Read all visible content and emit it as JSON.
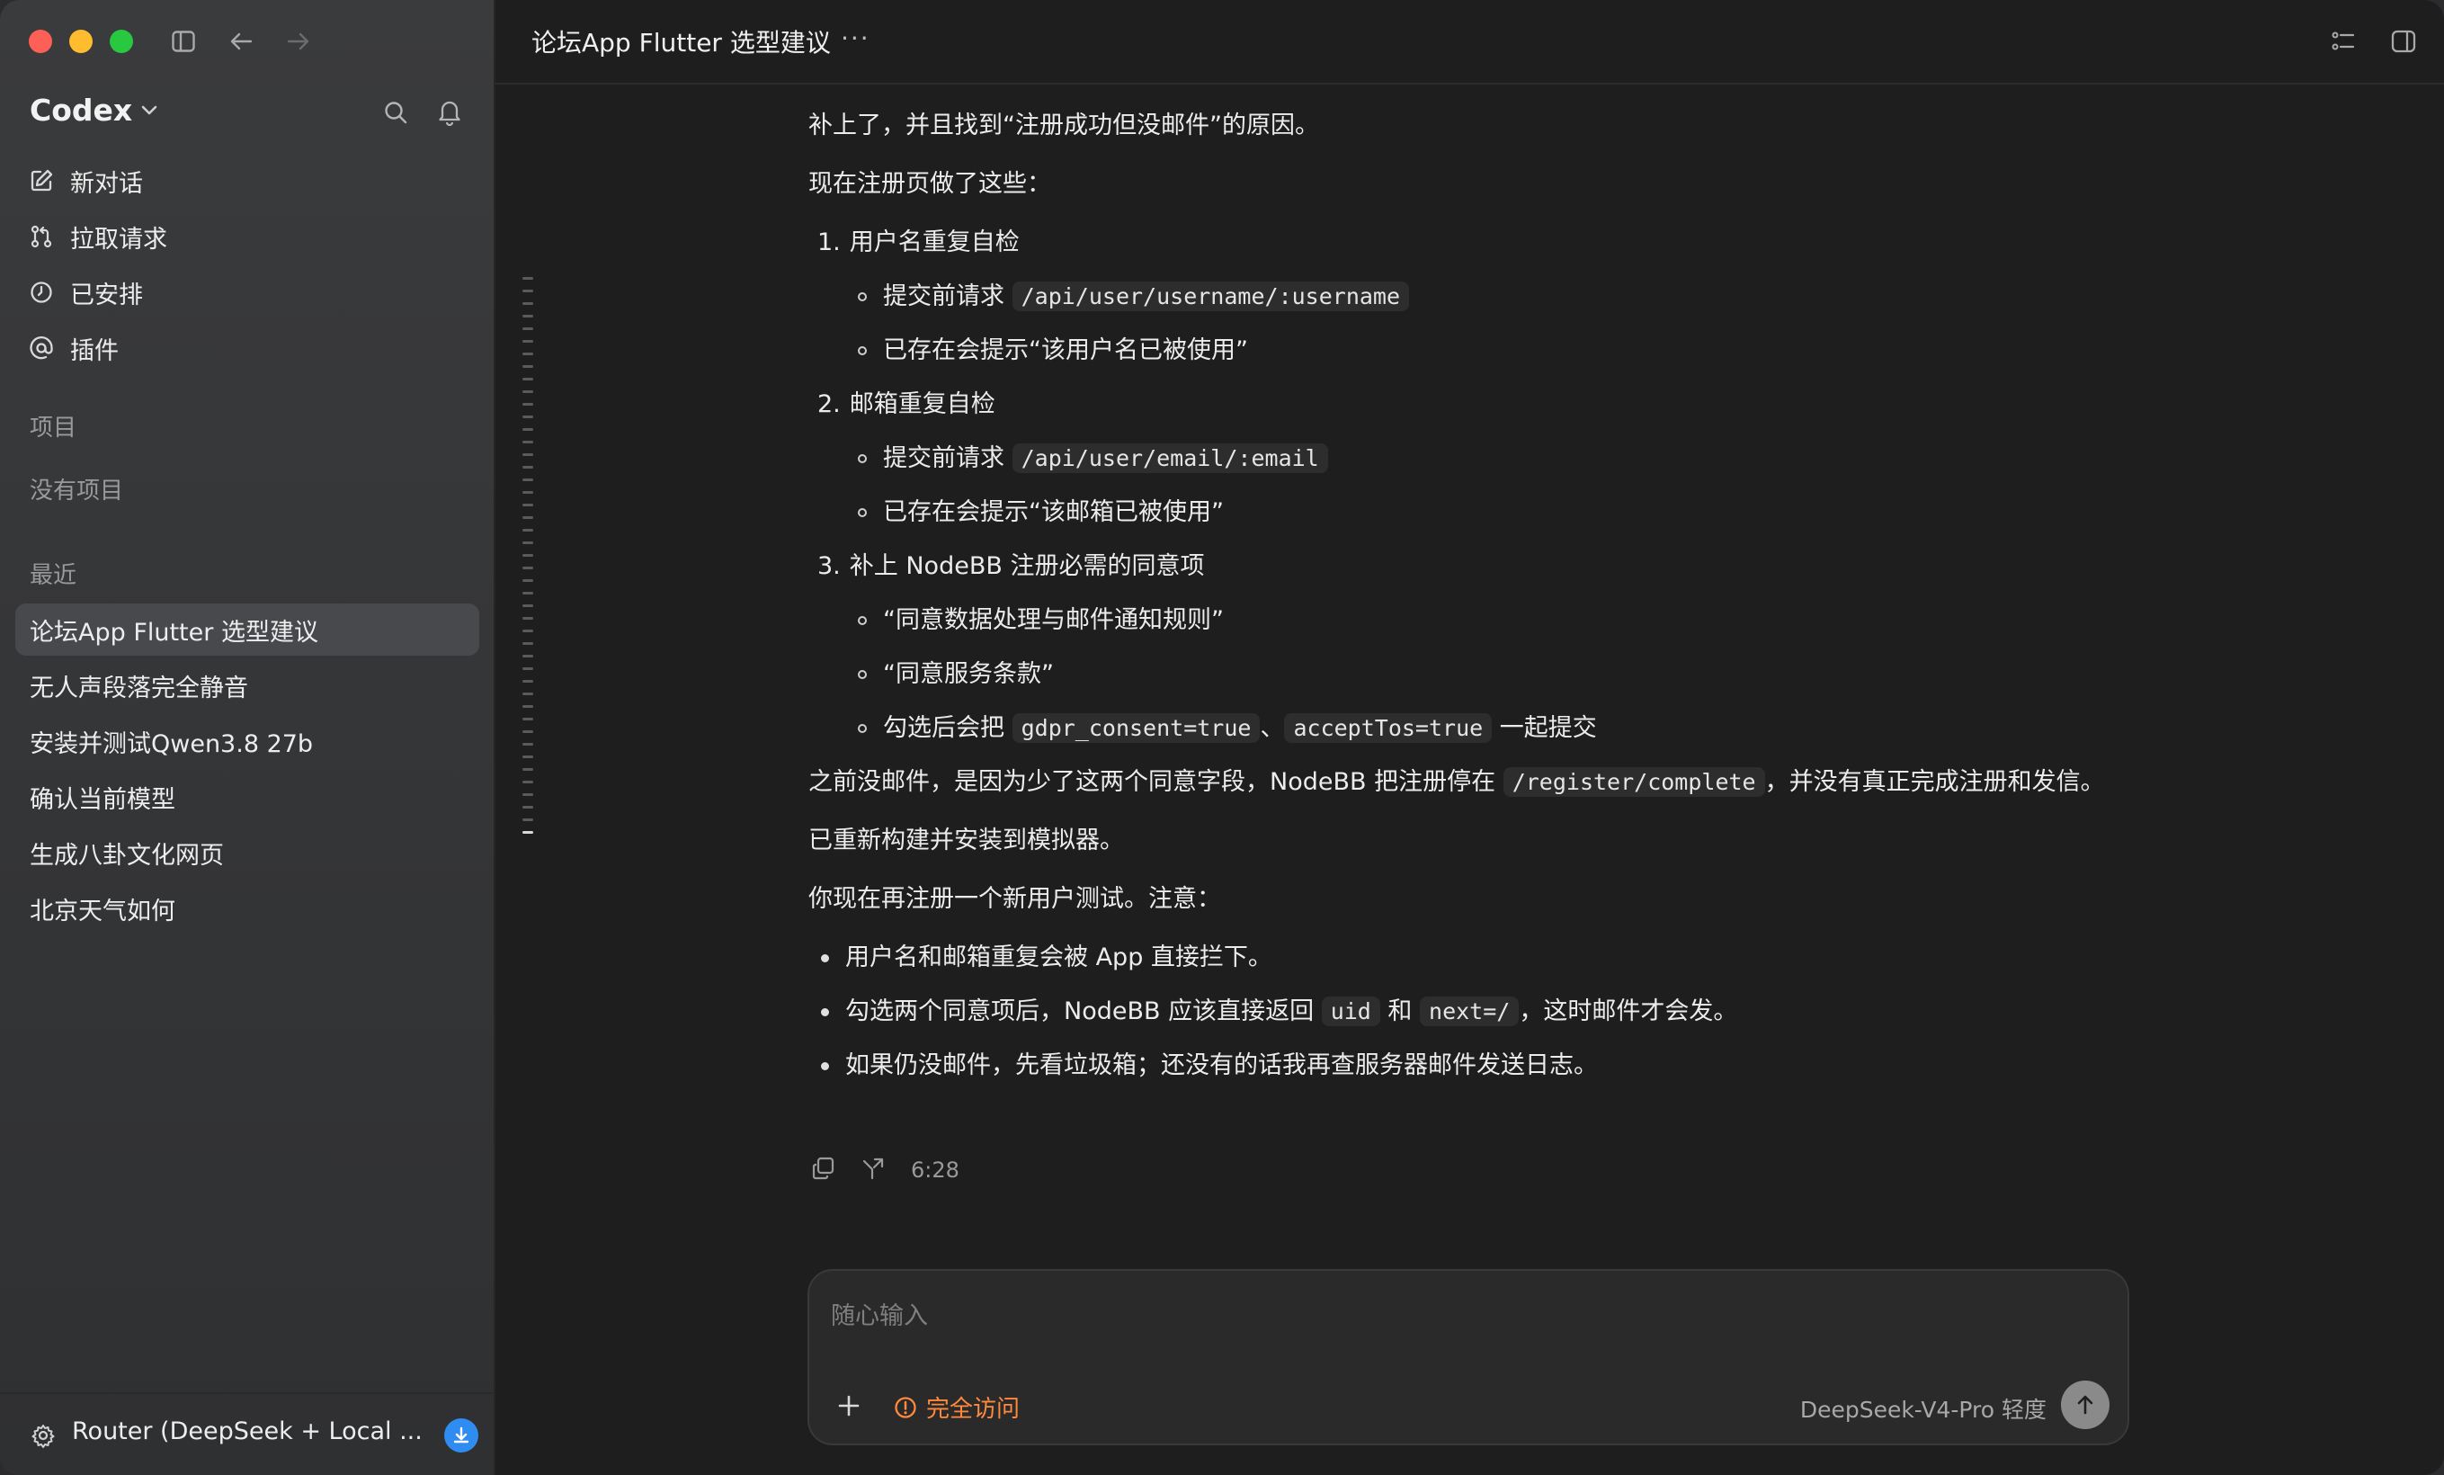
{
  "sidebar": {
    "brand": "Codex",
    "nav": [
      {
        "label": "新对话",
        "icon": "new-chat-icon"
      },
      {
        "label": "拉取请求",
        "icon": "pull-request-icon"
      },
      {
        "label": "已安排",
        "icon": "clock-icon"
      },
      {
        "label": "插件",
        "icon": "at-icon"
      }
    ],
    "projects_title": "项目",
    "projects_empty": "没有项目",
    "recent_title": "最近",
    "recent": [
      {
        "label": "论坛App Flutter 选型建议",
        "active": true
      },
      {
        "label": "无人声段落完全静音"
      },
      {
        "label": "安装并测试Qwen3.8 27b"
      },
      {
        "label": "确认当前模型"
      },
      {
        "label": "生成八卦文化网页"
      },
      {
        "label": "北京天气如何"
      }
    ],
    "footer_label": "Router (DeepSeek + Local ..."
  },
  "topbar": {
    "title": "论坛App Flutter 选型建议",
    "more": "···"
  },
  "message": {
    "p1": "补上了，并且找到“注册成功但没邮件”的原因。",
    "p2": "现在注册页做了这些：",
    "items": [
      {
        "num": "1.",
        "title": "用户名重复自检",
        "sub": [
          {
            "pre": "提交前请求 ",
            "code": "/api/user/username/:username"
          },
          {
            "text": "已存在会提示“该用户名已被使用”"
          }
        ]
      },
      {
        "num": "2.",
        "title": "邮箱重复自检",
        "sub": [
          {
            "pre": "提交前请求 ",
            "code": "/api/user/email/:email"
          },
          {
            "text": "已存在会提示“该邮箱已被使用”"
          }
        ]
      },
      {
        "num": "3.",
        "title": "补上 NodeBB 注册必需的同意项",
        "sub": [
          {
            "text": "“同意数据处理与邮件通知规则”"
          },
          {
            "text": "“同意服务条款”"
          },
          {
            "pre": "勾选后会把 ",
            "code": "gdpr_consent=true",
            "mid": "、",
            "code2": "acceptTos=true",
            "post": " 一起提交"
          }
        ]
      }
    ],
    "p3_pre": "之前没邮件，是因为少了这两个同意字段，NodeBB 把注册停在 ",
    "p3_code": "/register/complete",
    "p3_post": "，并没有真正完成注册和发信。",
    "p4": "已重新构建并安装到模拟器。",
    "p5": "你现在再注册一个新用户测试。注意：",
    "bullets": {
      "b1": "用户名和邮箱重复会被 App 直接拦下。",
      "b2_pre": "勾选两个同意项后，NodeBB 应该直接返回 ",
      "b2_code1": "uid",
      "b2_mid": " 和 ",
      "b2_code2": "next=/",
      "b2_post": "，这时邮件才会发。",
      "b3": "如果仍没邮件，先看垃圾箱；还没有的话我再查服务器邮件发送日志。"
    },
    "time": "6:28"
  },
  "composer": {
    "placeholder": "随心输入",
    "access_label": "完全访问",
    "model_label": "DeepSeek-V4-Pro  轻度"
  },
  "colors": {
    "accent_access": "#ff8a3d",
    "download_badge": "#2f8cf0"
  }
}
